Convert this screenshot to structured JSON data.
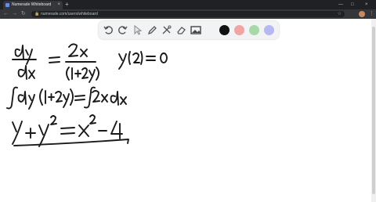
{
  "browser": {
    "tab_title": "Numerade Whiteboard",
    "tab_close": "×",
    "new_tab": "+",
    "url": "numerade.com/users/whiteboard",
    "minimize": "—",
    "maximize": "□",
    "close": "×",
    "back": "←",
    "forward": "→",
    "reload": "↻",
    "lock": "🔒",
    "star": "☆",
    "menu": "⋮"
  },
  "whiteboard_toolbar": {
    "tools": [
      "undo-icon",
      "redo-icon",
      "select-icon",
      "pen-icon",
      "tools-icon",
      "eraser-icon",
      "image-icon"
    ],
    "colors": [
      "#111111",
      "#f4a3a3",
      "#a7d8a7",
      "#b7b7f3"
    ]
  },
  "colors": {
    "ink": "#1a1a1a"
  }
}
